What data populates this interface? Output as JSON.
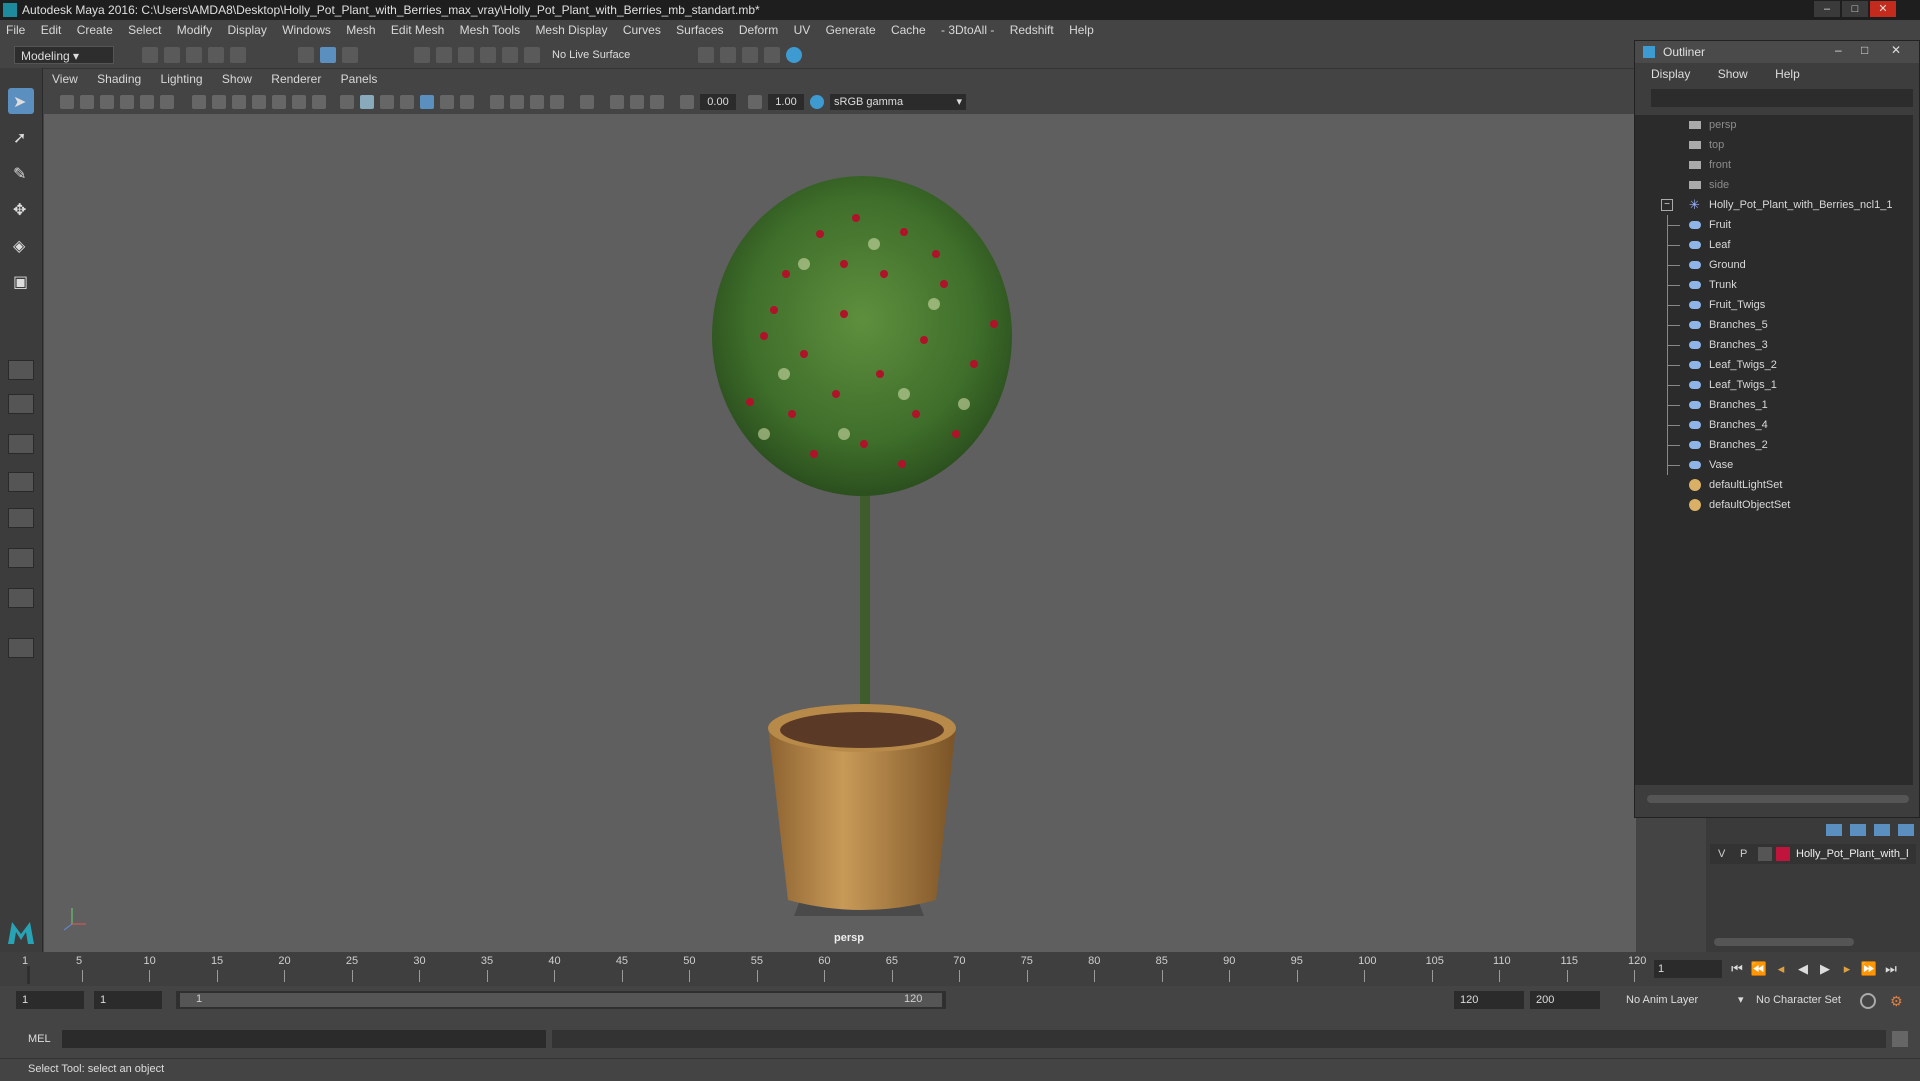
{
  "window": {
    "title": "Autodesk Maya 2016: C:\\Users\\AMDA8\\Desktop\\Holly_Pot_Plant_with_Berries_max_vray\\Holly_Pot_Plant_with_Berries_mb_standart.mb*",
    "minimize": "–",
    "maximize": "□",
    "close": "✕"
  },
  "menubar": [
    "File",
    "Edit",
    "Create",
    "Select",
    "Modify",
    "Display",
    "Windows",
    "Mesh",
    "Edit Mesh",
    "Mesh Tools",
    "Mesh Display",
    "Curves",
    "Surfaces",
    "Deform",
    "UV",
    "Generate",
    "Cache",
    "- 3DtoAll -",
    "Redshift",
    "Help"
  ],
  "statusline": {
    "mode": "Modeling",
    "live_surface": "No Live Surface"
  },
  "panel_menu": [
    "View",
    "Shading",
    "Lighting",
    "Show",
    "Renderer",
    "Panels"
  ],
  "view_toolbar": {
    "exposure": "0.00",
    "gamma": "1.00",
    "color_space": "sRGB gamma"
  },
  "viewport": {
    "camera": "persp"
  },
  "outliner": {
    "title": "Outliner",
    "menu": [
      "Display",
      "Show",
      "Help"
    ],
    "cameras": [
      "persp",
      "top",
      "front",
      "side"
    ],
    "group": "Holly_Pot_Plant_with_Berries_ncl1_1",
    "children": [
      "Fruit",
      "Leaf",
      "Ground",
      "Trunk",
      "Fruit_Twigs",
      "Branches_5",
      "Branches_3",
      "Leaf_Twigs_2",
      "Leaf_Twigs_1",
      "Branches_1",
      "Branches_4",
      "Branches_2",
      "Vase"
    ],
    "sets": [
      "defaultLightSet",
      "defaultObjectSet"
    ]
  },
  "layer": {
    "v": "V",
    "p": "P",
    "name": "Holly_Pot_Plant_with_l",
    "color": "#c0143c"
  },
  "timeslider": {
    "ticks": [
      "1",
      "5",
      "10",
      "15",
      "20",
      "25",
      "30",
      "35",
      "40",
      "45",
      "50",
      "55",
      "60",
      "65",
      "70",
      "75",
      "80",
      "85",
      "90",
      "95",
      "100",
      "105",
      "110",
      "115",
      "120"
    ],
    "min_frame": 1,
    "max_frame": 120,
    "current": "1"
  },
  "range": {
    "start": "1",
    "playback_start": "1",
    "range_start_label": "1",
    "range_end_label": "120",
    "playback_end": "120",
    "end": "200",
    "anim_layer": "No Anim Layer",
    "character_set": "No Character Set"
  },
  "cmd": {
    "lang": "MEL"
  },
  "help": {
    "text": "Select Tool: select an object"
  },
  "colors": {
    "accent": "#5b8fbf",
    "berry": "#b0122a",
    "leaf": "#3f7a2e",
    "pot": "#b88a4a"
  }
}
